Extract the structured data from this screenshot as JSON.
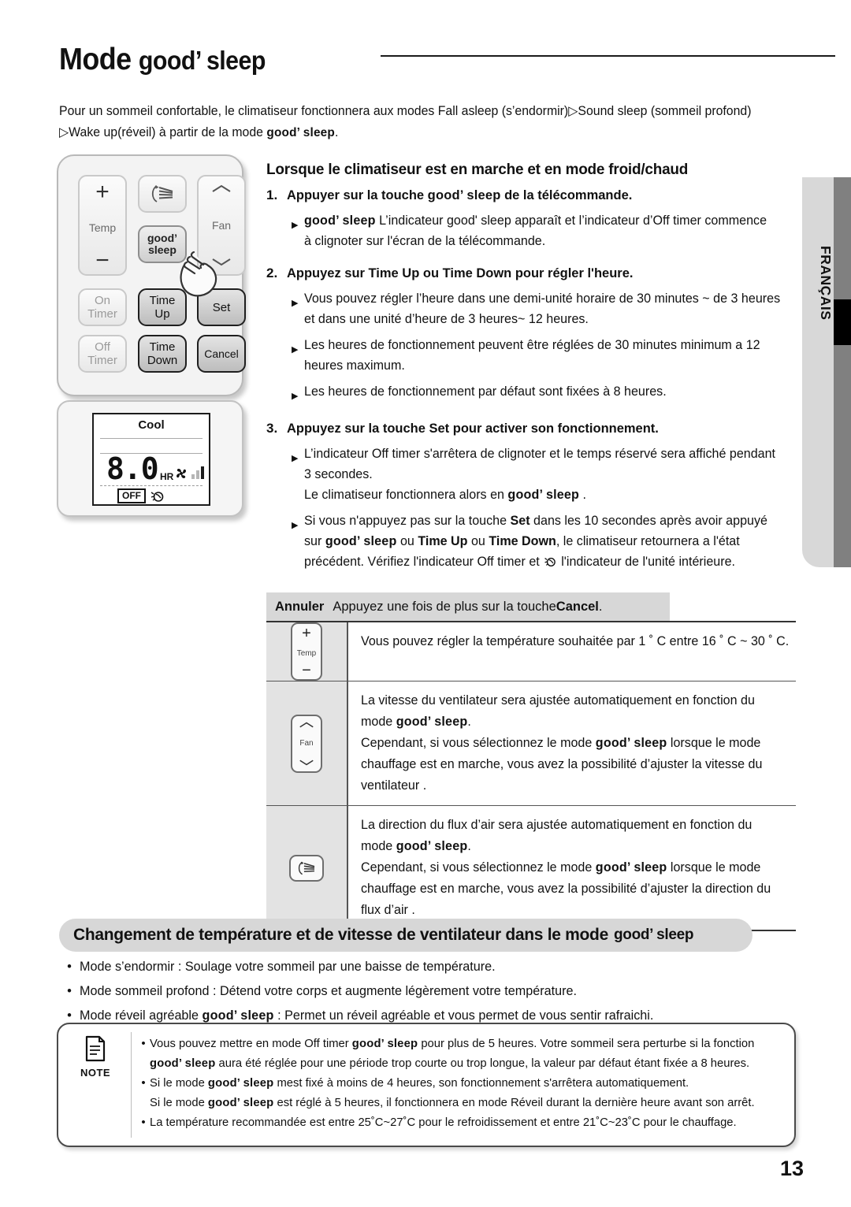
{
  "header": {
    "title_prefix": "Mode ",
    "title_brand": "good’ sleep"
  },
  "intro": {
    "line1": "Pour un sommeil confortable, le climatiseur fonctionnera aux modes Fall asleep (s’endormir)▷Sound sleep (sommeil profond)",
    "line2_pre": "▷Wake up(réveil) à partir de la mode ",
    "line2_brand": "good’ sleep",
    "line2_post": "."
  },
  "language_tab": {
    "label": "FRANÇAIS"
  },
  "remote": {
    "buttons": [
      {
        "name": "temp",
        "plus": "+",
        "label": "Temp",
        "minus": "−"
      },
      {
        "name": "airflow",
        "icon": "airflow-icon"
      },
      {
        "name": "fan",
        "up": "chevron-up",
        "label": "Fan",
        "down": "chevron-down"
      },
      {
        "name": "good-sleep",
        "line1": "good’",
        "line2": "sleep"
      },
      {
        "name": "on-timer",
        "line1": "On",
        "line2": "Timer"
      },
      {
        "name": "time-up",
        "line1": "Time",
        "line2": "Up"
      },
      {
        "name": "set",
        "line1": "Set"
      },
      {
        "name": "off-timer",
        "line1": "Off",
        "line2": "Timer"
      },
      {
        "name": "time-down",
        "line1": "Time",
        "line2": "Down"
      },
      {
        "name": "cancel",
        "line1": "Cancel"
      }
    ]
  },
  "lcd": {
    "mode": "Cool",
    "value": "8.0",
    "unit": "HR",
    "off_label": "OFF"
  },
  "section_main": {
    "heading": "Lorsque le climatiseur est en marche et en mode froid/chaud",
    "steps": [
      {
        "num": "1.",
        "text_pre": "Appuyer sur la touche ",
        "brand": "good’ sleep",
        "text_post": " de la télécommande.",
        "bullets": [
          {
            "lines": [
              {
                "brand": "good’ sleep",
                "text": " L’indicateur good' sleep apparaît et  l’indicateur d’Off timer commence"
              },
              {
                "text": "à clignoter sur l'écran de la télécommande."
              }
            ]
          }
        ]
      },
      {
        "num": "2.",
        "text_pre": "Appuyez sur Time Up ou Time Down pour régler l'heure.",
        "bullets": [
          {
            "lines": [
              {
                "text": "Vous pouvez régler l’heure dans une demi-unité horaire de 30 minutes ~ de 3 heures"
              },
              {
                "text": "et dans une unité d’heure de 3 heures~ 12 heures."
              }
            ]
          },
          {
            "lines": [
              {
                "text": "Les heures de fonctionnement peuvent être réglées de 30 minutes minimum a 12"
              },
              {
                "text": "heures maximum."
              }
            ]
          },
          {
            "lines": [
              {
                "text": "Les heures de fonctionnement par défaut sont fixées à 8 heures."
              }
            ]
          }
        ]
      },
      {
        "num": "3.",
        "text_pre": "Appuyez sur la touche Set pour activer son fonctionnement.",
        "bullets": [
          {
            "lines": [
              {
                "text": "L’indicateur Off timer s'arrêtera de clignoter et le temps réservé sera affiché pendant"
              },
              {
                "text": "3 secondes."
              },
              {
                "text": "Le climatiseur fonctionnera alors en ",
                "brand_after": "good’ sleep",
                "text_after": " ."
              }
            ]
          },
          {
            "lines": [
              {
                "text": "Si vous n'appuyez pas sur la touche ",
                "bold": "Set",
                "text2": " dans les 10 secondes après avoir appuyé"
              },
              {
                "text": "sur ",
                "brandmix": "good’ sleep",
                "mid": " ou ",
                "bold1": "Time Up",
                "mid2": " ou ",
                "bold2": "Time Down",
                "tail": ", le climatiseur retournera a l'état"
              },
              {
                "text": "précédent. Vérifiez l'indicateur Off timer et ",
                "icon": "sleep-moon-icon",
                "tail2": " l'indicateur de l'unité intérieure."
              }
            ]
          }
        ]
      }
    ]
  },
  "annuler": {
    "label": "Annuler",
    "text_pre": "Appuyez une fois de plus sur la touche ",
    "bold": "Cancel",
    "text_post": "."
  },
  "table": {
    "rows": [
      {
        "icon": "temp-button-icon",
        "icon_labels": {
          "plus": "+",
          "label": "Temp",
          "minus": "−"
        },
        "lines": [
          {
            "text": "Vous pouvez régler la température souhaitée par 1 ˚ C entre 16 ˚ C ~ 30 ˚ C."
          }
        ]
      },
      {
        "icon": "fan-button-icon",
        "icon_labels": {
          "label": "Fan"
        },
        "lines": [
          {
            "text": "La vitesse du ventilateur sera ajustée automatiquement en fonction du"
          },
          {
            "text": "mode ",
            "brand": "good’ sleep",
            "tail": "."
          },
          {
            "text": "Cependant, si vous sélectionnez le mode ",
            "brand": "good’ sleep",
            "tail": " lorsque le mode"
          },
          {
            "text": "chauffage est en marche, vous avez la possibilité d’ajuster la vitesse du"
          },
          {
            "text": "ventilateur ."
          }
        ]
      },
      {
        "icon": "airflow-button-icon",
        "icon_labels": {},
        "lines": [
          {
            "text": "La direction du flux d’air sera ajustée automatiquement en fonction du"
          },
          {
            "text": "mode ",
            "brand": "good’ sleep",
            "tail": "."
          },
          {
            "text": "Cependant, si vous sélectionnez le mode ",
            "brand": "good’ sleep",
            "tail": " lorsque le mode"
          },
          {
            "text": "chauffage est en marche, vous avez la possibilité d’ajuster la direction du"
          },
          {
            "text": "flux d’air ."
          }
        ]
      }
    ]
  },
  "section_change": {
    "heading_pre": "Changement de température et de vitesse de ventilateur dans le mode ",
    "heading_brand": "good’ sleep",
    "bullets": [
      {
        "text": "Mode s’endormir : Soulage votre sommeil par une baisse de température."
      },
      {
        "text": "Mode sommeil profond : Détend votre corps et augmente légèrement votre température."
      },
      {
        "text_pre": "Mode réveil agréable ",
        "brand": "good’ sleep",
        "text_post": " : Permet un réveil agréable et vous permet de vous sentir rafraichi."
      }
    ]
  },
  "note": {
    "label": "NOTE",
    "items": [
      {
        "lines": [
          {
            "text": "Vous pouvez mettre en mode Off timer ",
            "brand": "good’ sleep",
            "tail": " pour plus de 5 heures. Votre sommeil sera perturbe si la fonction"
          },
          {
            "brand_first": "good’ sleep",
            "tail": " aura été réglée pour une période trop courte ou trop longue, la valeur par défaut étant fixée a 8 heures."
          }
        ]
      },
      {
        "lines": [
          {
            "text": "Si le mode ",
            "brand": "good’ sleep",
            "tail": " mest fixé à moins de 4 heures, son fonctionnement s'arrêtera automatiquement."
          },
          {
            "text": "Si le mode ",
            "brand": "good’ sleep",
            "tail": " est réglé à 5 heures, il fonctionnera en mode Réveil durant la dernière heure avant son arrêt."
          }
        ]
      },
      {
        "lines": [
          {
            "text": "La température recommandée est entre 25˚C~27˚C pour le refroidissement et entre 21˚C~23˚C pour le chauffage."
          }
        ]
      }
    ]
  },
  "footer": {
    "page_number": "13"
  },
  "colors": {
    "gray_bar": "#d7d7d7",
    "tab_light": "#d8d8d8",
    "tab_dark": "#808080"
  }
}
